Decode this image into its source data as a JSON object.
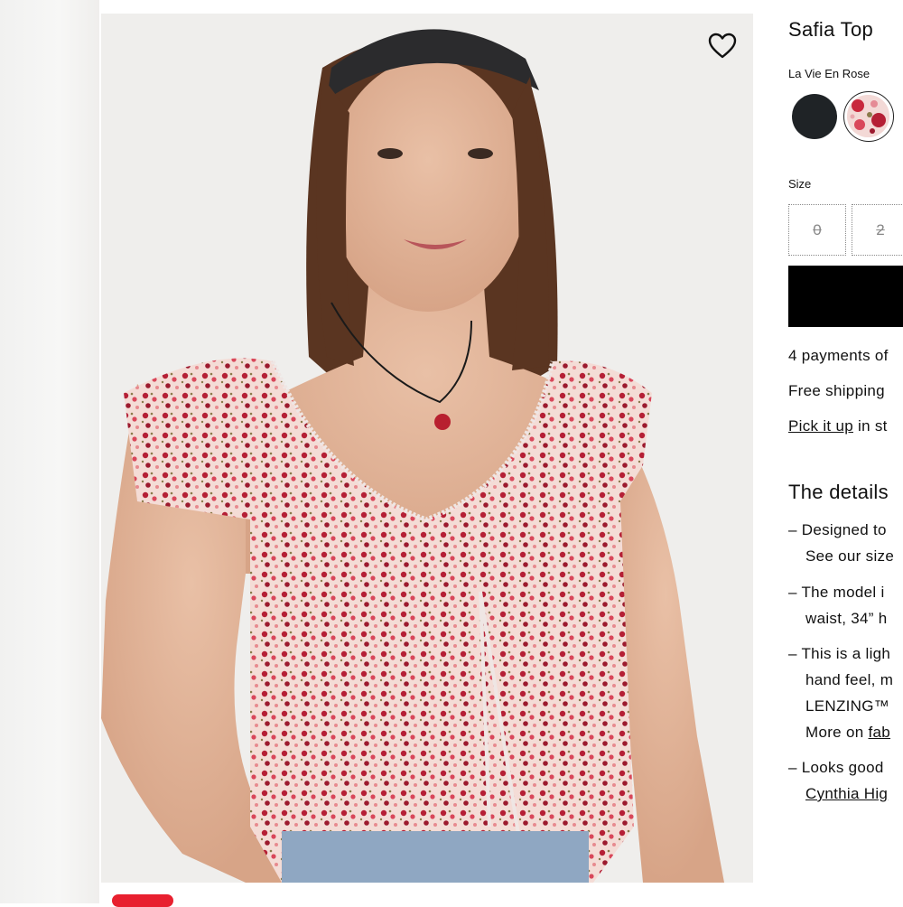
{
  "product": {
    "title": "Safia Top",
    "color_name": "La Vie En Rose",
    "swatches": [
      {
        "name": "black",
        "color": "#1f2326"
      },
      {
        "name": "la-vie-en-rose",
        "color": "#c8283c"
      }
    ],
    "size_label": "Size",
    "sizes": [
      "0",
      "2"
    ],
    "add_button_color": "#000000"
  },
  "favorite_icon": "heart-outline-icon",
  "purchase_info": {
    "payments": "4 payments of",
    "shipping": "Free shipping",
    "pickup_link": "Pick it up",
    "pickup_rest": " in st"
  },
  "details": {
    "heading": "The details",
    "items": [
      {
        "lines": [
          "– Designed to",
          "See our size"
        ]
      },
      {
        "lines": [
          "– The model i",
          "waist, 34” h"
        ]
      },
      {
        "lines": [
          "– This is a ligh",
          "hand feel, m",
          "LENZING™",
          "More on "
        ],
        "link": "fab"
      },
      {
        "lines": [
          "– Looks good"
        ],
        "link": "Cynthia Hig"
      }
    ]
  },
  "accent": "#e8202f"
}
